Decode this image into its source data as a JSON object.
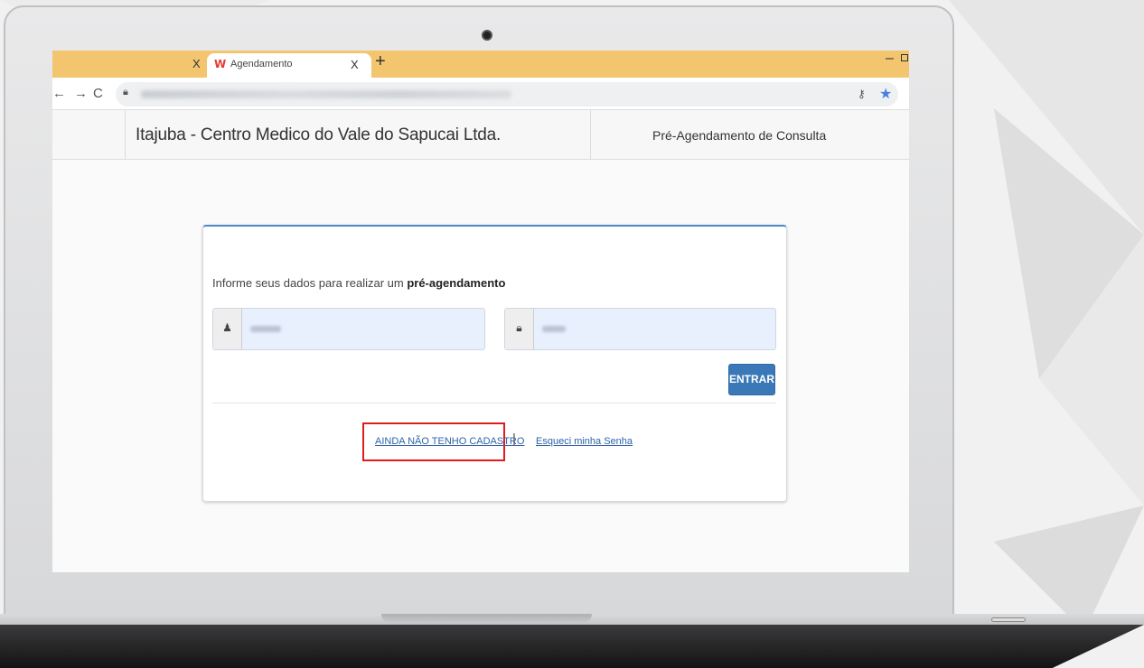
{
  "browser": {
    "tabs": [
      {
        "close_glyph": "X"
      },
      {
        "favicon": "W",
        "title": "Agendamento",
        "close_glyph": "X"
      }
    ],
    "new_tab_glyph": "+",
    "nav": {
      "back": "←",
      "forward": "→",
      "reload": "C"
    },
    "icons": [
      "lock-icon",
      "key-icon",
      "star-icon"
    ],
    "accent_tabbar": "#f2c56e"
  },
  "site": {
    "title": "Itajuba - Centro Medico do Vale do Sapucai Ltda.",
    "subtitle": "Pré-Agendamento de Consulta"
  },
  "login": {
    "instruction_prefix": "Informe seus dados para realizar um ",
    "instruction_bold": "pré-agendamento",
    "user_icon": "user-icon",
    "password_icon": "lock-icon",
    "submit_label": "ENTRAR",
    "register_link": "AINDA NÃO TENHO CADASTRO",
    "separator": "|",
    "forgot_link": "Esqueci minha Senha",
    "button_color": "#3a78b8",
    "highlight_color": "#e01c1c"
  }
}
